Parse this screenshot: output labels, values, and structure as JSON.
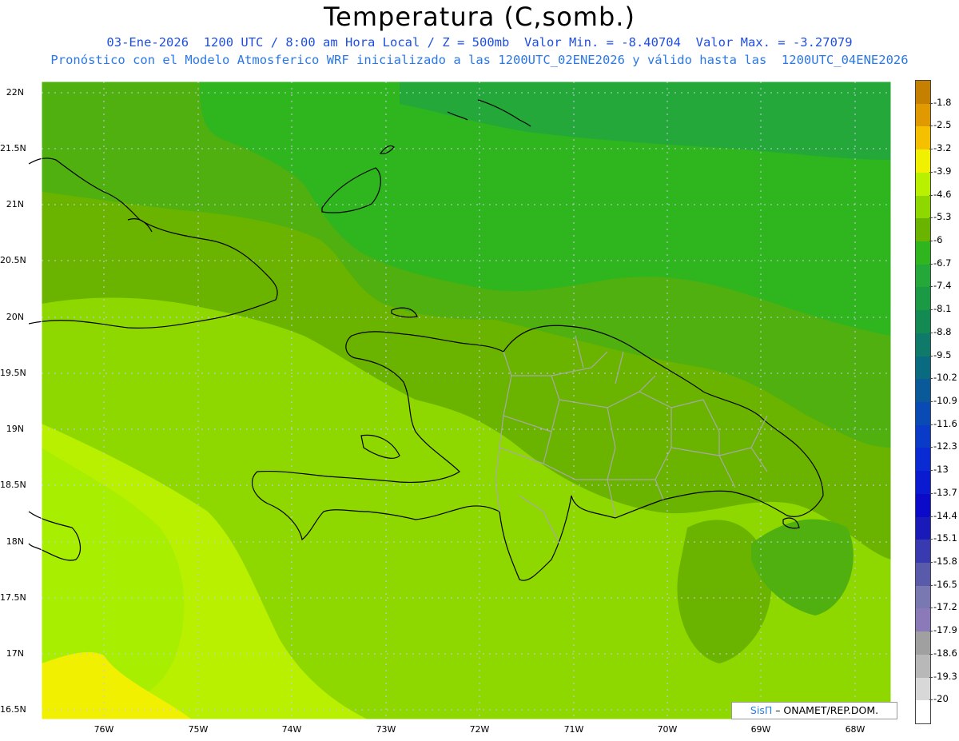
{
  "title": "Temperatura (C,somb.)",
  "subtitle_1": "03-Ene-2026  1200 UTC / 8:00 am Hora Local / Z = 500mb  Valor Min. = -8.40704  Valor Max. = -3.27079",
  "subtitle_2": "Pronóstico con el Modelo Atmosferico WRF inicializado a las 1200UTC_02ENE2026 y válido hasta las  1200UTC_04ENE2026",
  "lat_labels": [
    "22N",
    "21.5N",
    "21N",
    "20.5N",
    "20N",
    "19.5N",
    "19N",
    "18.5N",
    "18N",
    "17.5N",
    "17N",
    "16.5N"
  ],
  "lon_labels": [
    "76W",
    "75W",
    "74W",
    "73W",
    "72W",
    "71W",
    "70W",
    "69W",
    "68W"
  ],
  "colorbar": {
    "labels": [
      "-1.8",
      "-2.5",
      "-3.2",
      "-3.9",
      "-4.6",
      "-5.3",
      "-6",
      "-6.7",
      "-7.4",
      "-8.1",
      "-8.8",
      "-9.5",
      "-10.2",
      "-10.9",
      "-11.6",
      "-12.3",
      "-13",
      "-13.7",
      "-14.4",
      "-15.1",
      "-15.8",
      "-16.5",
      "-17.2",
      "-17.9",
      "-18.6",
      "-19.3",
      "-20"
    ],
    "colors": [
      "#c58000",
      "#e09a00",
      "#f5c000",
      "#f0f000",
      "#b8f000",
      "#8ed800",
      "#6ab400",
      "#2fb51e",
      "#24a83a",
      "#1a9a44",
      "#138a52",
      "#0f7a6a",
      "#0a6a80",
      "#0a5a9a",
      "#0a4ab4",
      "#0a3ac8",
      "#0a2ad4",
      "#0a1ad0",
      "#0a0ac8",
      "#1a1ab8",
      "#3a3ab0",
      "#5a5aaa",
      "#7a78b0",
      "#8a7ab8",
      "#a0a0a0",
      "#b8b8b8",
      "#d8d8d8",
      "#ffffff"
    ]
  },
  "credit": {
    "brand": "SisΠ",
    "text": " – ONAMET/REP.DOM."
  }
}
